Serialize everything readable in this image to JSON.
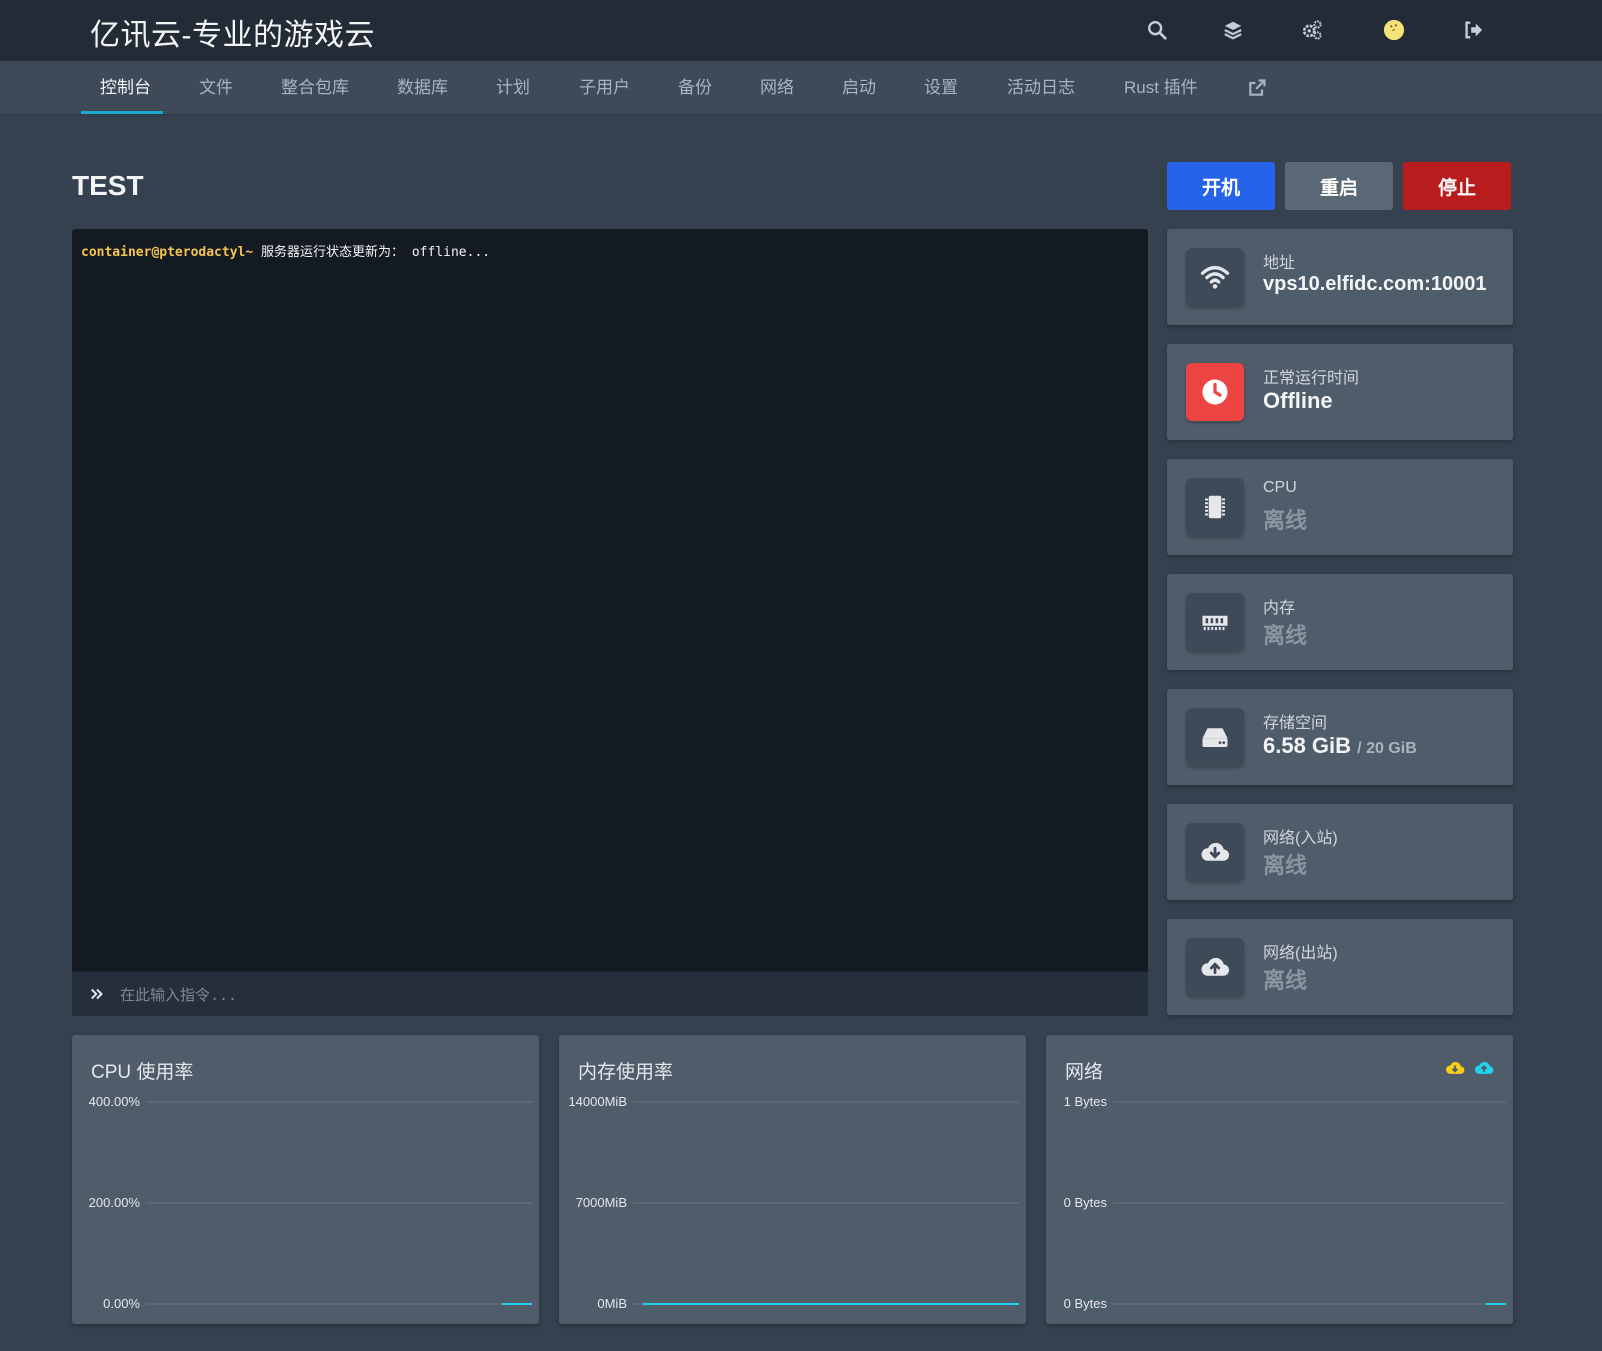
{
  "header": {
    "brand": "亿讯云-专业的游戏云",
    "icons": [
      "search-icon",
      "layers-icon",
      "settings-icon",
      "avatar",
      "logout-icon"
    ]
  },
  "nav": {
    "items": [
      {
        "label": "控制台",
        "active": true
      },
      {
        "label": "文件"
      },
      {
        "label": "整合包库"
      },
      {
        "label": "数据库"
      },
      {
        "label": "计划"
      },
      {
        "label": "子用户"
      },
      {
        "label": "备份"
      },
      {
        "label": "网络"
      },
      {
        "label": "启动"
      },
      {
        "label": "设置"
      },
      {
        "label": "活动日志"
      },
      {
        "label": "Rust 插件"
      }
    ],
    "external_icon": "external-link-icon"
  },
  "server": {
    "name": "TEST",
    "buttons": {
      "start": "开机",
      "restart": "重启",
      "stop": "停止"
    }
  },
  "console": {
    "prompt": "container@pterodactyl~",
    "line": " 服务器运行状态更新为： offline...",
    "input_placeholder": "在此输入指令..."
  },
  "stats": {
    "address": {
      "label": "地址",
      "value": "vps10.elfidc.com:10001",
      "icon": "wifi-icon"
    },
    "uptime": {
      "label": "正常运行时间",
      "value": "Offline",
      "icon": "clock-icon"
    },
    "cpu": {
      "label": "CPU",
      "value": "离线",
      "icon": "cpu-chip-icon"
    },
    "memory": {
      "label": "内存",
      "value": "离线",
      "icon": "memory-icon"
    },
    "disk": {
      "label": "存储空间",
      "value": "6.58 GiB",
      "limit": "/ 20 GiB",
      "icon": "hard-drive-icon"
    },
    "net_in": {
      "label": "网络(入站)",
      "value": "离线",
      "icon": "cloud-download-icon"
    },
    "net_out": {
      "label": "网络(出站)",
      "value": "离线",
      "icon": "cloud-upload-icon"
    }
  },
  "colors": {
    "accent": "#19a8d0",
    "start_button": "#2563eb",
    "restart_button": "#5a6774",
    "stop_button": "#b91c1c",
    "uptime_icon_bg": "#ef4444",
    "prompt": "#f5c451",
    "legend_download": "#facc15",
    "legend_upload": "#22d3ee"
  },
  "chart_data": [
    {
      "type": "line",
      "title": "CPU 使用率",
      "ylim": [
        0,
        400
      ],
      "yticks": [
        "400.00%",
        "200.00%",
        "0.00%"
      ],
      "series": [
        {
          "values": [
            0,
            0
          ]
        }
      ]
    },
    {
      "type": "line",
      "title": "内存使用率",
      "ylim": [
        0,
        14000
      ],
      "yticks": [
        "14000MiB",
        "7000MiB",
        "0MiB"
      ],
      "series": [
        {
          "values": [
            0,
            0
          ]
        }
      ]
    },
    {
      "type": "line",
      "title": "网络",
      "ylim": [
        0,
        1
      ],
      "yticks": [
        "1 Bytes",
        "0 Bytes",
        "0 Bytes"
      ],
      "legend": [
        "cloud-download-icon",
        "cloud-upload-icon"
      ],
      "series": [
        {
          "values": [
            0,
            0
          ]
        },
        {
          "values": [
            0,
            0
          ]
        }
      ]
    }
  ]
}
